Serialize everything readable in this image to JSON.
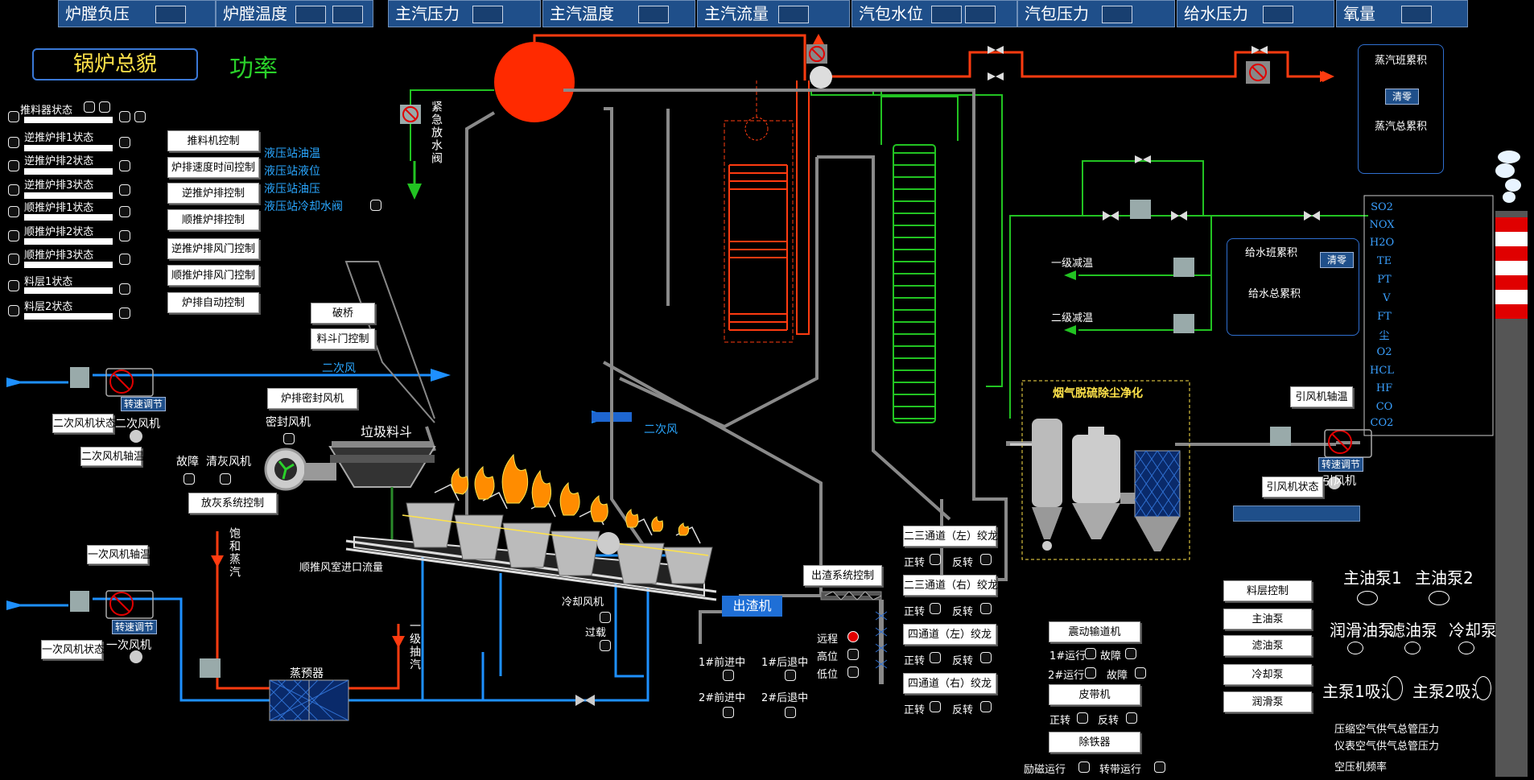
{
  "top_bar": [
    {
      "label": "炉膛负压"
    },
    {
      "label": "炉膛温度"
    },
    {
      "label": "主汽压力"
    },
    {
      "label": "主汽温度"
    },
    {
      "label": "主汽流量"
    },
    {
      "label": "汽包水位"
    },
    {
      "label": "汽包压力"
    },
    {
      "label": "给水压力"
    },
    {
      "label": "氧量"
    }
  ],
  "header": {
    "title": "锅炉总貌",
    "power_label": "功率"
  },
  "grate_status": [
    {
      "label": "推料器状态"
    },
    {
      "label": "逆推炉排1状态"
    },
    {
      "label": "逆推炉排2状态"
    },
    {
      "label": "逆推炉排3状态"
    },
    {
      "label": "顺推炉排1状态"
    },
    {
      "label": "顺推炉排2状态"
    },
    {
      "label": "顺推炉排3状态"
    },
    {
      "label": "料层1状态"
    },
    {
      "label": "料层2状态"
    }
  ],
  "control_buttons": [
    {
      "label": "推料机控制"
    },
    {
      "label": "炉排速度时间控制"
    },
    {
      "label": "逆推炉排控制"
    },
    {
      "label": "顺推炉排控制"
    },
    {
      "label": "逆推炉排风门控制"
    },
    {
      "label": "顺推炉排风门控制"
    },
    {
      "label": "炉排自动控制"
    }
  ],
  "hydraulic": [
    {
      "label": "液压站油温"
    },
    {
      "label": "液压站液位"
    },
    {
      "label": "液压站油压"
    },
    {
      "label": "液压站冷却水阀"
    }
  ],
  "emergency_valve": "紧急放水阀",
  "secondary_air": {
    "flow_label": "二次风",
    "speed_btn": "转速调节",
    "status_btn": "二次风机状态",
    "fan_label": "二次风机",
    "bearing_btn": "二次风机轴温",
    "inlet_label": "二次风"
  },
  "hopper": {
    "bridge_btn": "破桥",
    "door_btn": "料斗门控制",
    "seal_fan_btn": "炉排密封风机",
    "seal_fan_label": "密封风机",
    "hopper_label": "垃圾料斗"
  },
  "ash": {
    "fault": "故障",
    "clean_fan": "清灰风机",
    "ash_ctrl_btn": "放灰系统控制"
  },
  "primary_air": {
    "bearing_btn": "一次风机轴温",
    "speed_btn": "转速调节",
    "status_btn": "一次风机状态",
    "fan_label": "一次风机",
    "preheater": "蒸预器",
    "sat_steam": "饱和蒸汽",
    "extraction": "一级抽汽",
    "inlet_label": "顺推风室进口流量"
  },
  "cooling": {
    "fan": "冷却风机",
    "overload": "过载"
  },
  "slag": {
    "machine": "出渣机",
    "ctrl_btn": "出渣系统控制",
    "remote": "远程",
    "high": "高位",
    "low": "低位",
    "fwd1": "1#前进中",
    "back1": "1#后退中",
    "fwd2": "2#前进中",
    "back2": "2#后退中"
  },
  "conveyors": [
    {
      "label": "二三通道（左）绞龙",
      "fwd": "正转",
      "rev": "反转"
    },
    {
      "label": "二三通道（右）绞龙",
      "fwd": "正转",
      "rev": "反转"
    },
    {
      "label": "四通道（左）绞龙",
      "fwd": "正转",
      "rev": "反转"
    },
    {
      "label": "四通道（右）绞龙",
      "fwd": "正转",
      "rev": "反转"
    }
  ],
  "vibration": {
    "btn": "震动输道机",
    "run1": "1#运行",
    "fault1": "故障",
    "run2": "2#运行",
    "fault2": "故障",
    "belt_btn": "皮带机",
    "fwd": "正转",
    "rev": "反转",
    "iron_btn": "除铁器",
    "excite": "励磁运行",
    "rotate": "转带运行"
  },
  "oil": {
    "buttons": [
      {
        "label": "料层控制"
      },
      {
        "label": "主油泵"
      },
      {
        "label": "滤油泵"
      },
      {
        "label": "冷却泵"
      },
      {
        "label": "润滑泵"
      }
    ],
    "main_pump1": "主油泵1",
    "main_pump2": "主油泵2",
    "lube_pump": "润滑油泵",
    "filter_pump": "滤油泵",
    "cool_pump": "冷却泵",
    "main1_suction": "主泵1吸油",
    "main2_suction": "主泵2吸油"
  },
  "air_comp": {
    "line1": "压缩空气供气总管压力",
    "line2": "仪表空气供气总管压力",
    "line3": "空压机频率"
  },
  "steam_panel": {
    "shift": "蒸汽班累积",
    "clear": "清零",
    "total": "蒸汽总累积"
  },
  "feed_panel": {
    "shift": "给水班累积",
    "clear": "清零",
    "total": "给水总累积"
  },
  "desuper": {
    "first": "一级减温",
    "second": "二级减温"
  },
  "flue_gas": {
    "title": "烟气脱硫除尘净化"
  },
  "induced_fan": {
    "bearing_btn": "引风机轴温",
    "speed_btn": "转速调节",
    "status_btn": "引风机状态",
    "fan_label": "引风机",
    "bar_label": ""
  },
  "gas_labels": [
    "SO2",
    "NOX",
    "H2O",
    "TE",
    "PT",
    "V",
    "FT",
    "尘",
    "O2",
    "HCL",
    "HF",
    "CO",
    "CO2"
  ]
}
